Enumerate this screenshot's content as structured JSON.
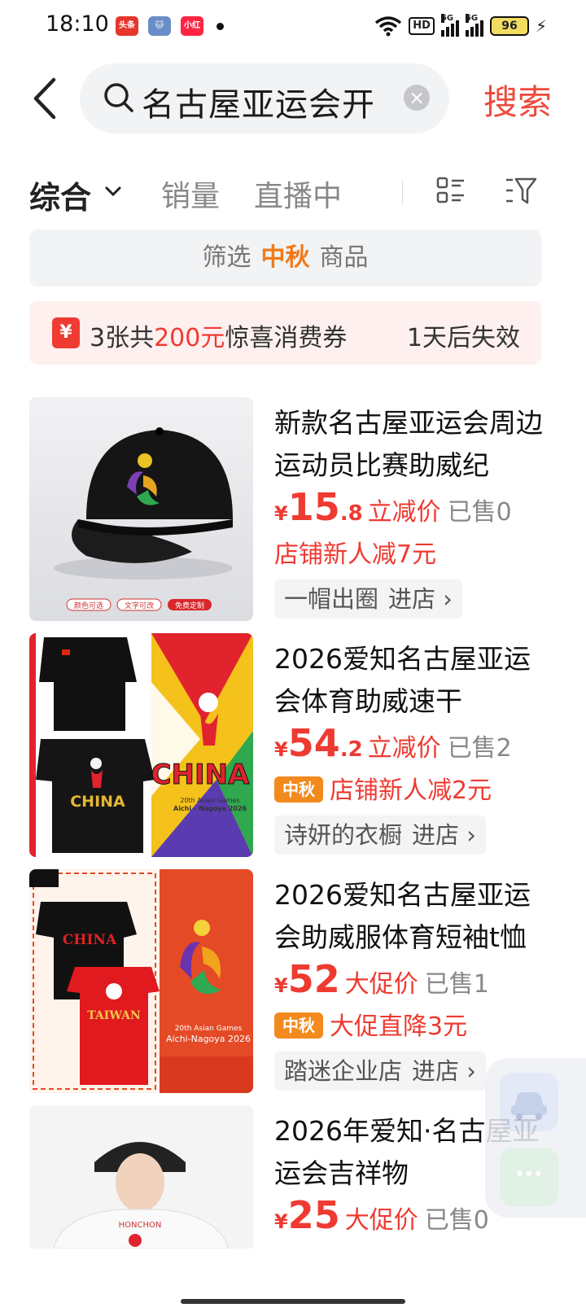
{
  "status_bar": {
    "time": "18:10",
    "apps": [
      "头条",
      "cat-app-icon",
      "小红书"
    ],
    "hd": "HD",
    "network1": "5G",
    "network2": "5G",
    "battery": "96"
  },
  "search": {
    "query": "名古屋亚运会开",
    "button": "搜索"
  },
  "tabs": {
    "comprehensive": "综合",
    "sales": "销量",
    "live": "直播中"
  },
  "filter_banner": {
    "prefix": "筛选",
    "highlight": "中秋",
    "suffix": "商品"
  },
  "coupon": {
    "icon": "¥",
    "text_a": "3张共",
    "text_b": "200元",
    "text_c": "惊喜消费券",
    "expire": "1天后失效"
  },
  "products": [
    {
      "title": "新款名古屋亚运会周边运动员比赛助威纪",
      "yen": "¥",
      "price_int": "15",
      "price_dec": ".8",
      "price_tag": "立减价",
      "sold": "已售0",
      "badge": "",
      "promo": "店铺新人减7元",
      "shop": "一帽出圈",
      "enter": "进店 ›",
      "img_tags": [
        "颜色可选",
        "文字可改",
        "免费定制"
      ]
    },
    {
      "title": "2026爱知名古屋亚运会体育助威速干",
      "yen": "¥",
      "price_int": "54",
      "price_dec": ".2",
      "price_tag": "立减价",
      "sold": "已售2",
      "badge": "中秋",
      "promo": "店铺新人减2元",
      "shop": "诗妍的衣橱",
      "enter": "进店 ›",
      "img_texts": [
        "CHINA",
        "20th Asian Games",
        "Aichi - Nagoya 2026"
      ]
    },
    {
      "title": "2026爱知名古屋亚运会助威服体育短袖t恤",
      "yen": "¥",
      "price_int": "52",
      "price_dec": "",
      "price_tag": "大促价",
      "sold": "已售1",
      "badge": "中秋",
      "promo": "大促直降3元",
      "shop": "踏迷企业店",
      "enter": "进店 ›",
      "img_texts": [
        "CHINA",
        "TAIWAN",
        "20th Asian Games",
        "Aichi-Nagoya 2026"
      ]
    },
    {
      "title": "2026年爱知·名古屋亚运会吉祥物",
      "yen": "¥",
      "price_int": "25",
      "price_dec": "",
      "price_tag": "大促价",
      "sold": "已售0",
      "img_texts": [
        "HONCHON"
      ]
    }
  ],
  "colors": {
    "accent_red": "#ee3a31",
    "orange": "#f28a1d",
    "bg_gray": "#f2f3f5"
  }
}
